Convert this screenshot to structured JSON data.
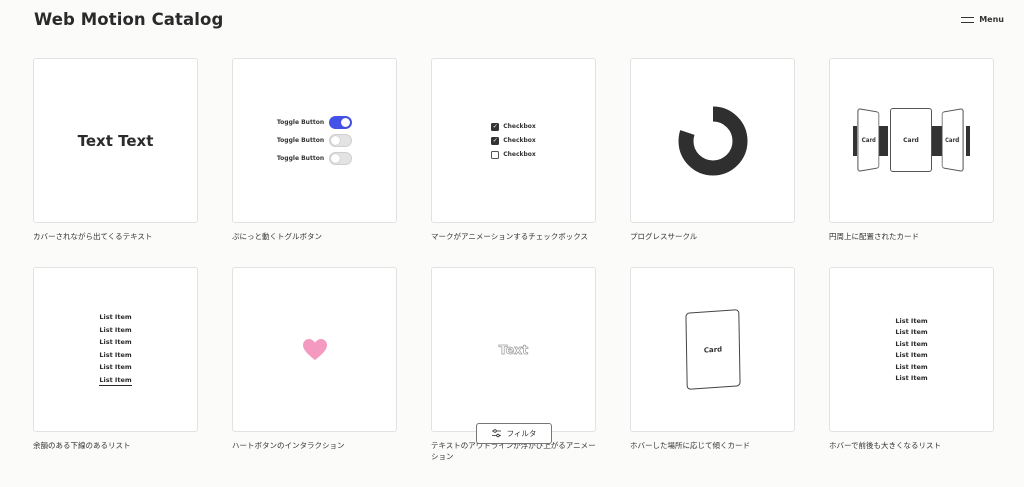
{
  "header": {
    "title": "Web Motion Catalog",
    "menu_label": "Menu"
  },
  "filter": {
    "label": "フィルタ"
  },
  "items": [
    {
      "caption": "カバーされながら出てくるテキスト",
      "demo_text": "Text Text"
    },
    {
      "caption": "ぷにっと動くトグルボタン",
      "toggles": [
        {
          "label": "Toggle Button",
          "on": true
        },
        {
          "label": "Toggle Button",
          "on": false
        },
        {
          "label": "Toggle Button",
          "on": false
        }
      ]
    },
    {
      "caption": "マークがアニメーションするチェックボックス",
      "checkboxes": [
        {
          "label": "Checkbox",
          "checked": true
        },
        {
          "label": "Checkbox",
          "checked": true
        },
        {
          "label": "Checkbox",
          "checked": false
        }
      ]
    },
    {
      "caption": "プログレスサークル",
      "progress": 0.8
    },
    {
      "caption": "円周上に配置されたカード",
      "cards": [
        "Card",
        "Card",
        "Card"
      ]
    },
    {
      "caption": "余韻のある下線のあるリスト",
      "list": [
        "List Item",
        "List Item",
        "List Item",
        "List Item",
        "List Item",
        "List Item"
      ]
    },
    {
      "caption": "ハートボタンのインタラクション",
      "icon": "heart-icon",
      "heart_color": "#f49ac1"
    },
    {
      "caption": "テキストのアウトラインが浮かび上がるアニメーション",
      "demo_text": "Text"
    },
    {
      "caption": "ホバーした場所に応じて傾くカード",
      "card_label": "Card"
    },
    {
      "caption": "ホバーで前後も大きくなるリスト",
      "list": [
        "List Item",
        "List Item",
        "List Item",
        "List Item",
        "List Item",
        "List Item"
      ]
    }
  ],
  "colors": {
    "accent": "#4552e8",
    "dark": "#2f2f2f"
  }
}
